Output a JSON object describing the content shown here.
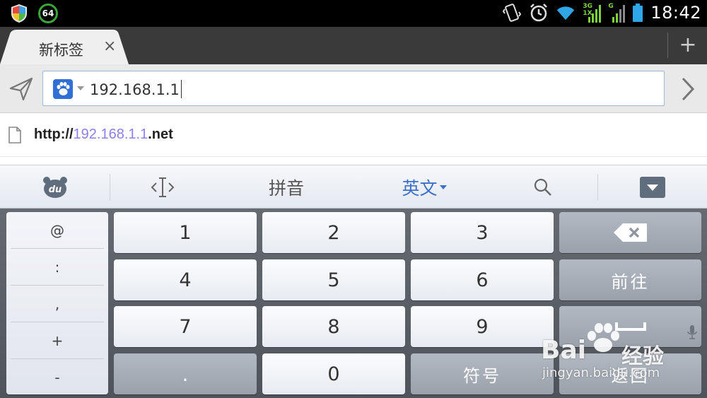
{
  "status_bar": {
    "notification_count": "64",
    "network_3g": "3G",
    "network_1x": "1X",
    "network_g": "G",
    "time": "18:42"
  },
  "tabs": [
    {
      "title": "新标签",
      "close": "×"
    }
  ],
  "new_tab_label": "+",
  "address_bar": {
    "url": "192.168.1.1"
  },
  "suggestion": {
    "prefix": "http://",
    "highlight": "192.168.1.1",
    "suffix": ".net"
  },
  "keyboard": {
    "toolbar": {
      "pinyin": "拼音",
      "english": "英文"
    },
    "symbols": [
      "@",
      ":",
      ",",
      "+",
      "-"
    ],
    "digits": [
      "1",
      "2",
      "3",
      "4",
      "5",
      "6",
      "7",
      "8",
      "9"
    ],
    "dot": ".",
    "zero": "0",
    "symbols_key": "符号",
    "go_key": "前往",
    "return_key": "返回"
  },
  "watermark": {
    "brand": "Bai",
    "brand_suffix": "经验",
    "url": "jingyan.baidu.com"
  },
  "colors": {
    "accent_blue": "#3b6fc9",
    "highlight_purple": "#8c7ff0",
    "status_green": "#3aa53a"
  }
}
